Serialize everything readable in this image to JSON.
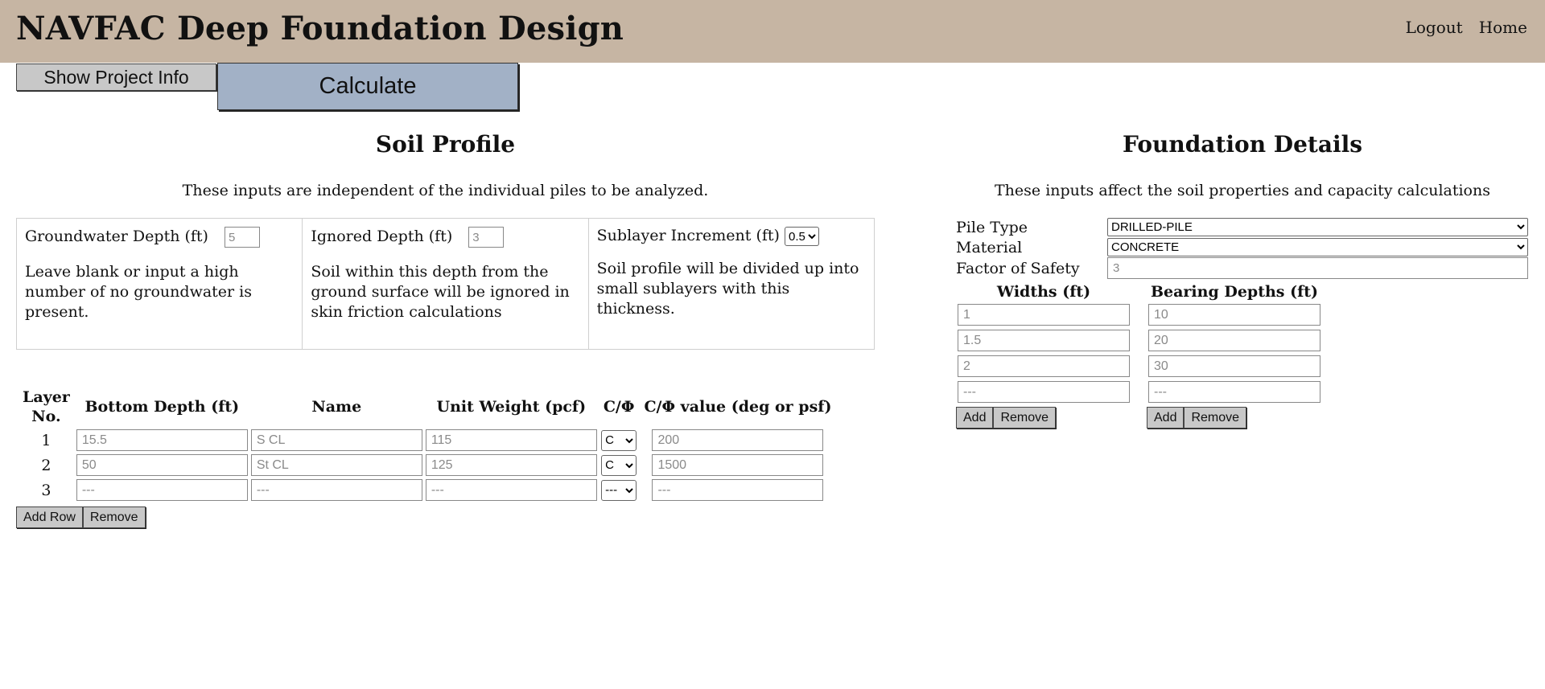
{
  "header": {
    "title": "NAVFAC Deep Foundation Design",
    "nav": [
      "Logout",
      "Home"
    ]
  },
  "buttons": {
    "project_info": "Show Project Info",
    "calculate": "Calculate"
  },
  "soil_profile": {
    "title": "Soil Profile",
    "subtitle": "These inputs are independent of the individual piles to be analyzed.",
    "settings": {
      "groundwater": {
        "label": "Groundwater Depth (ft)",
        "placeholder": "5",
        "desc": "Leave blank or input a high number of no groundwater is present."
      },
      "ignored": {
        "label": "Ignored Depth (ft)",
        "placeholder": "3",
        "desc": "Soil within this depth from the ground surface will be ignored in skin friction calculations"
      },
      "sublayer": {
        "label": "Sublayer Increment (ft)",
        "value": "0.5",
        "desc": "Soil profile will be divided up into small sublayers with this thickness."
      }
    },
    "table": {
      "headers": {
        "layer_no": "Layer No.",
        "bottom_depth": "Bottom Depth (ft)",
        "name": "Name",
        "unit_weight": "Unit Weight (pcf)",
        "c_phi": "C/Φ",
        "c_phi_value": "C/Φ value (deg or psf)"
      },
      "rows": [
        {
          "no": "1",
          "bottom_depth": "15.5",
          "name": "S CL",
          "unit_weight": "115",
          "c_phi": "C",
          "value": "200"
        },
        {
          "no": "2",
          "bottom_depth": "50",
          "name": "St CL",
          "unit_weight": "125",
          "c_phi": "C",
          "value": "1500"
        },
        {
          "no": "3",
          "bottom_depth": "---",
          "name": "---",
          "unit_weight": "---",
          "c_phi": "---",
          "value": "---"
        }
      ],
      "add_row": "Add Row",
      "remove": "Remove"
    }
  },
  "foundation": {
    "title": "Foundation Details",
    "subtitle": "These inputs affect the soil properties and capacity calculations",
    "pile_type": {
      "label": "Pile Type",
      "value": "DRILLED-PILE"
    },
    "material": {
      "label": "Material",
      "value": "CONCRETE"
    },
    "factor_of_safety": {
      "label": "Factor of Safety",
      "placeholder": "3"
    },
    "widths": {
      "label": "Widths (ft)",
      "values": [
        "1",
        "1.5",
        "2",
        "---"
      ],
      "add": "Add",
      "remove": "Remove"
    },
    "bearing_depths": {
      "label": "Bearing Depths (ft)",
      "values": [
        "10",
        "20",
        "30",
        "---"
      ],
      "add": "Add",
      "remove": "Remove"
    }
  }
}
